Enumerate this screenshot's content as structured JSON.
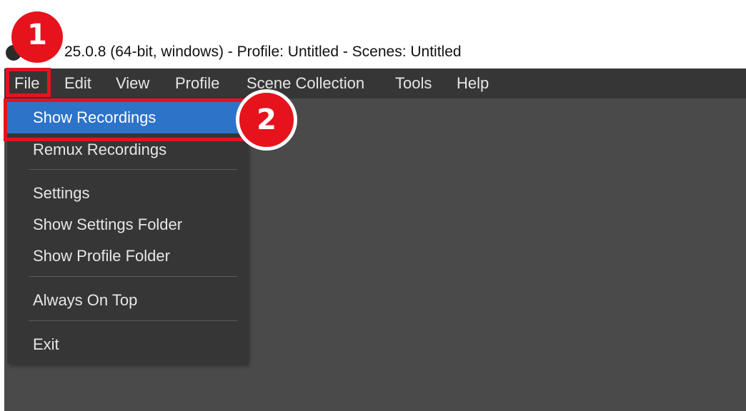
{
  "window": {
    "title_visible": "25.0.8 (64-bit, windows) - Profile: Untitled - Scenes: Untitled"
  },
  "menubar": {
    "items": [
      "File",
      "Edit",
      "View",
      "Profile",
      "Scene Collection",
      "Tools",
      "Help"
    ]
  },
  "file_menu": {
    "items": [
      {
        "label": "Show Recordings",
        "highlighted": true
      },
      {
        "label": "Remux Recordings"
      },
      {
        "label": "Settings"
      },
      {
        "label": "Show Settings Folder"
      },
      {
        "label": "Show Profile Folder"
      },
      {
        "label": "Always On Top"
      },
      {
        "label": "Exit"
      }
    ]
  },
  "annotations": {
    "step1": "1",
    "step2": "2"
  },
  "colors": {
    "menubar_bg": "#363636",
    "window_bg": "#4a4a4a",
    "highlight": "#2d73c8",
    "annotation_red": "#e6131d"
  }
}
